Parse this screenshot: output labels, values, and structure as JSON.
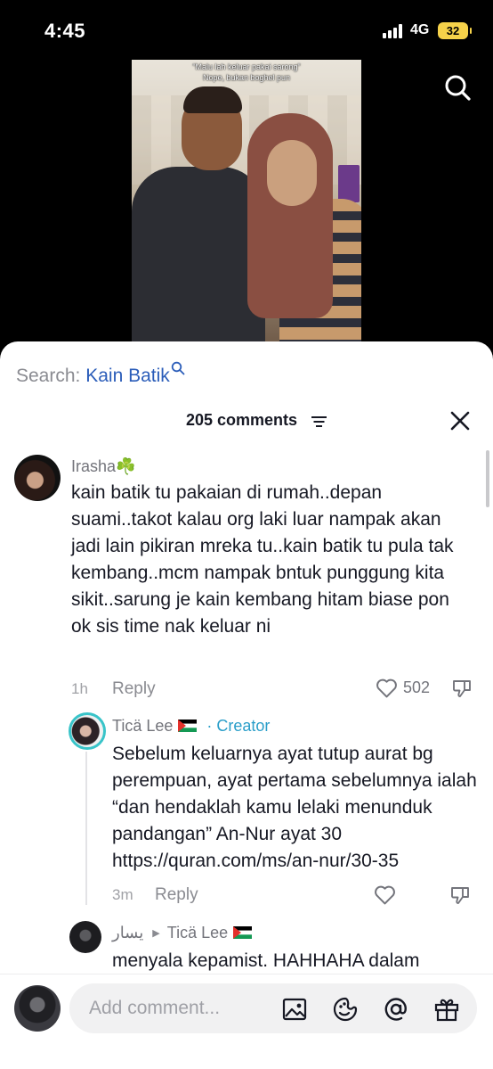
{
  "status_bar": {
    "time": "4:45",
    "network": "4G",
    "battery": "32"
  },
  "video": {
    "caption_line1": "“Malu lah keluar pakai sarong”",
    "caption_line2": "Nope, bukan boghel pun"
  },
  "search": {
    "prefix": "Search:",
    "term": "Kain Batik"
  },
  "comments_header": {
    "count_label": "205 comments"
  },
  "comments": [
    {
      "username": "Irasha☘️",
      "text": "kain batik tu pakaian di rumah..depan suami..takot kalau org laki luar nampak akan jadi lain pikiran mreka tu..kain batik tu pula tak kembang..mcm nampak bntuk punggung kita sikit..sarung je kain kembang hitam biase pon ok sis time nak keluar ni",
      "time": "1h",
      "reply_label": "Reply",
      "likes": "502"
    }
  ],
  "replies": [
    {
      "username": "Ticä Lee",
      "badge": "· Creator",
      "text": "Sebelum keluarnya ayat tutup aurat bg perempuan, ayat pertama sebelumnya ialah “dan hendaklah kamu lelaki menunduk pandangan” An-Nur ayat 30 https://quran.com/ms/an-nur/30-35",
      "time": "3m",
      "reply_label": "Reply"
    },
    {
      "username": "‫يسار‬",
      "reply_to": "Ticä Lee",
      "text": "menyala kepamist. HAHHAHA dalam"
    }
  ],
  "composer": {
    "placeholder": "Add comment..."
  },
  "colors": {
    "creator_accent": "#2a9ec9",
    "search_term": "#2b5db9",
    "battery": "#f6d24a"
  }
}
